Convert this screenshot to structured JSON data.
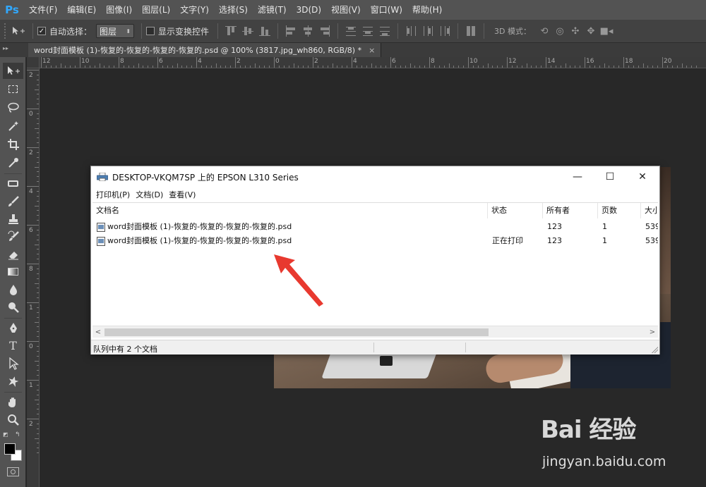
{
  "ps": {
    "logo": "Ps",
    "menu": [
      "文件(F)",
      "编辑(E)",
      "图像(I)",
      "图层(L)",
      "文字(Y)",
      "选择(S)",
      "滤镜(T)",
      "3D(D)",
      "视图(V)",
      "窗口(W)",
      "帮助(H)"
    ],
    "options": {
      "auto_select_label": "自动选择：",
      "auto_select_checked": true,
      "auto_select_value": "图层",
      "show_transform_label": "显示变换控件",
      "show_transform_checked": false,
      "mode_3d_label": "3D 模式："
    },
    "doc_tab": {
      "title": "word封面模板 (1)-恢复的-恢复的-恢复的-恢复的.psd @ 100% (3817.jpg_wh860, RGB/8) *",
      "close": "×"
    },
    "ruler_top_labels": [
      "12",
      "10",
      "8",
      "6",
      "4",
      "2",
      "0",
      "2",
      "4",
      "6",
      "8",
      "10",
      "12",
      "14",
      "16",
      "18",
      "20"
    ],
    "ruler_left_labels": [
      "2",
      "0",
      "2",
      "4",
      "6",
      "8",
      "1",
      "0",
      "1",
      "2"
    ]
  },
  "dialog": {
    "title": "DESKTOP-VKQM7SP 上的 EPSON L310 Series",
    "menu": [
      "打印机(P)",
      "文档(D)",
      "查看(V)"
    ],
    "columns": [
      "文档名",
      "状态",
      "所有者",
      "页数",
      "大小"
    ],
    "rows": [
      {
        "name": "word封面模板 (1)-恢复的-恢复的-恢复的-恢复的.psd",
        "status": "",
        "owner": "123",
        "pages": "1",
        "size": "539"
      },
      {
        "name": "word封面模板 (1)-恢复的-恢复的-恢复的-恢复的.psd",
        "status": "正在打印",
        "owner": "123",
        "pages": "1",
        "size": "539"
      }
    ],
    "status_bar": "队列中有 2 个文档",
    "win_controls": {
      "minimize": "—",
      "maximize": "☐",
      "close": "✕"
    }
  },
  "watermark": {
    "logo": "Bai 经验",
    "url": "jingyan.baidu.com"
  },
  "colors": {
    "ps_blue": "#31a8ff",
    "arrow_red": "#e8392f"
  }
}
